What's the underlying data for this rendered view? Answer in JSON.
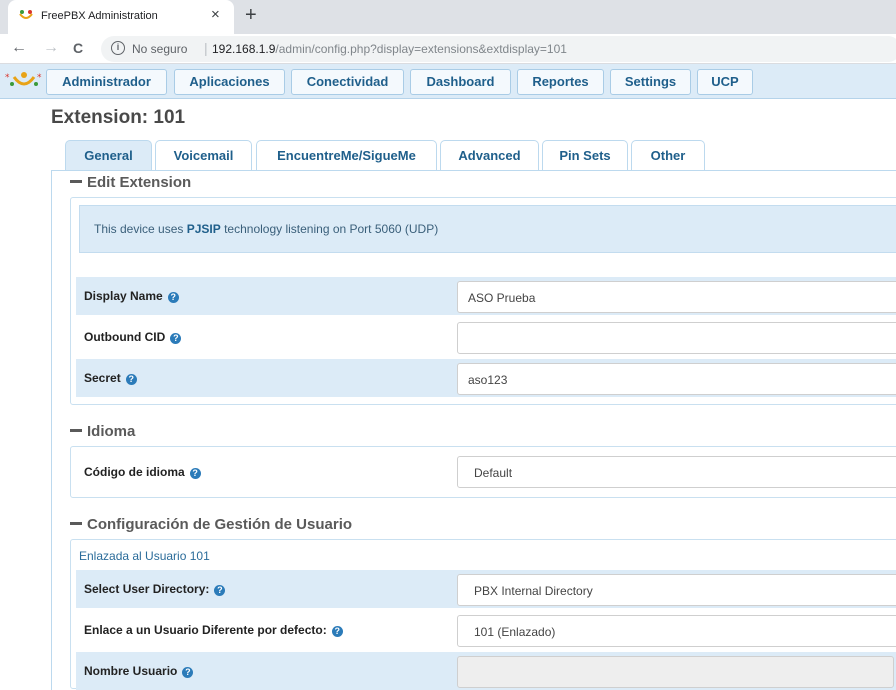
{
  "browser": {
    "tab_title": "FreePBX Administration",
    "tab_close": "×",
    "new_tab": "+",
    "back": "←",
    "forward": "→",
    "reload": "C",
    "info_glyph": "i",
    "security": "No seguro",
    "separator": "|",
    "url_host": "192.168.1.9",
    "url_path": "/admin/config.php?display=extensions&extdisplay=101"
  },
  "menu": [
    "Administrador",
    "Aplicaciones",
    "Conectividad",
    "Dashboard",
    "Reportes",
    "Settings",
    "UCP"
  ],
  "page_title": "Extension: 101",
  "tabs": [
    "General",
    "Voicemail",
    "EncuentreMe/SigueMe",
    "Advanced",
    "Pin Sets",
    "Other"
  ],
  "active_tab": "General",
  "help_glyph": "?",
  "sections": {
    "edit_extension": {
      "title": "Edit Extension",
      "alert_pre": "This device uses ",
      "alert_tech": "PJSIP",
      "alert_post": " technology listening on Port 5060 (UDP)",
      "fields": [
        {
          "label": "Display Name",
          "value": "ASO Prueba"
        },
        {
          "label": "Outbound CID",
          "value": ""
        },
        {
          "label": "Secret",
          "value": "aso123"
        }
      ]
    },
    "idioma": {
      "title": "Idioma",
      "fields": [
        {
          "label": "Código de idioma",
          "value": "Default"
        }
      ]
    },
    "user_mgmt": {
      "title": "Configuración de Gestión de Usuario",
      "linked": "Enlazada al Usuario 101",
      "fields": [
        {
          "label": "Select User Directory:",
          "value": "PBX Internal Directory"
        },
        {
          "label": "Enlace a un Usuario Diferente por defecto:",
          "value": "101 (Enlazado)"
        },
        {
          "label": "Nombre Usuario",
          "value": ""
        }
      ]
    }
  },
  "colors": {
    "menu_bg": "#dcebf7",
    "accent": "#1f5f8b",
    "help_icon": "#2b7bb9",
    "row_shade": "#dcebf7"
  }
}
